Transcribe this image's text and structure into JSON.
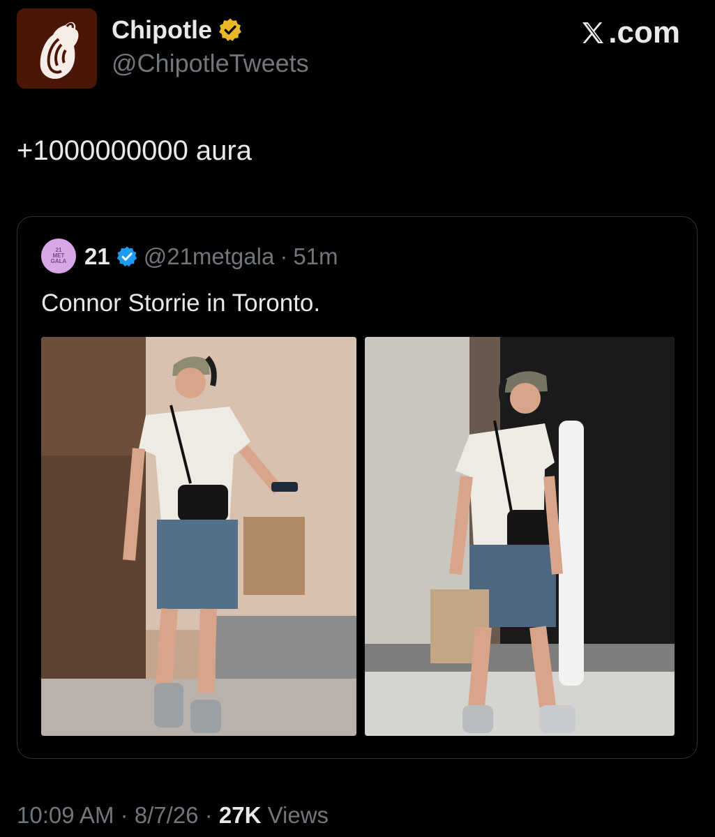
{
  "post": {
    "author_name": "Chipotle",
    "author_handle": "@ChipotleTweets",
    "text": "+1000000000 aura",
    "time": "10:09 AM",
    "date": "8/7/26",
    "separator": "·",
    "views_count": "27K",
    "views_label": "Views"
  },
  "branding": {
    "site": ".com"
  },
  "quote": {
    "avatar_text": [
      "21",
      "MET",
      "GALA"
    ],
    "author_name": "21",
    "author_handle": "@21metgala",
    "separator": "·",
    "time": "51m",
    "text": "Connor Storrie in Toronto."
  },
  "icons": {
    "avatar": "chipotle-pepper-logo",
    "author_badge": "gold-verified-badge",
    "quote_badge": "blue-verified-badge",
    "site_logo": "x-logo"
  },
  "colors": {
    "background": "#000000",
    "text_primary": "#e7e9ea",
    "text_secondary": "#71767b",
    "avatar_bg": "#4a1607",
    "gold_badge": "#e8b829",
    "blue_badge": "#1d9bf0",
    "quote_avatar_bg": "#d9a6e8"
  }
}
